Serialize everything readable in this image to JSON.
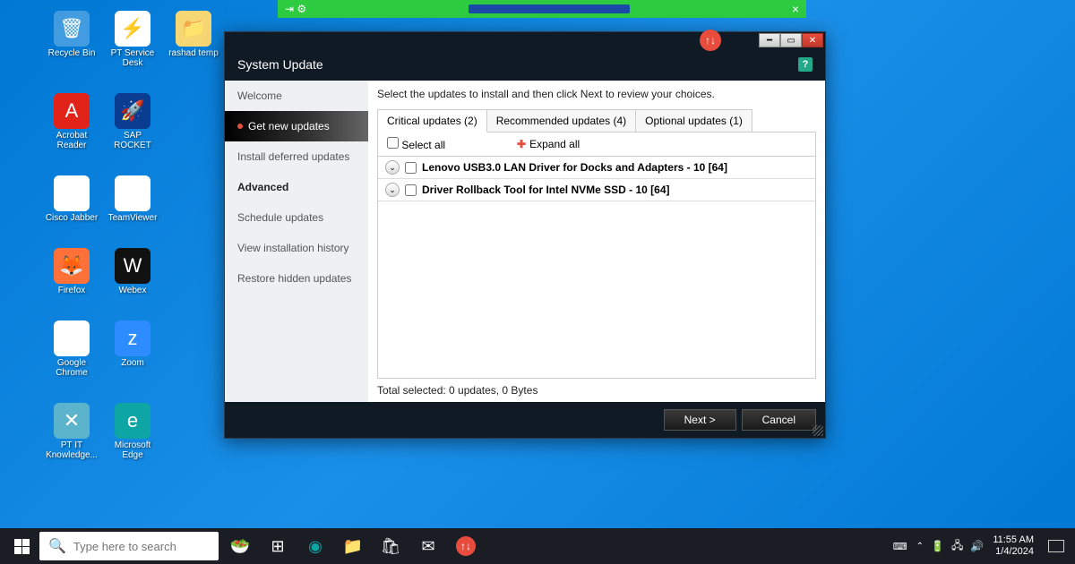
{
  "top_bar": {
    "close": "×"
  },
  "desktop": {
    "icons": [
      {
        "label": "Recycle Bin",
        "color": "#ffffff40",
        "glyph": "🗑"
      },
      {
        "label": "PT Service Desk",
        "color": "#fff",
        "glyph": "⚡"
      },
      {
        "label": "rashad temp",
        "color": "#f7d774",
        "glyph": "📁"
      },
      {
        "label": "Acrobat Reader",
        "color": "#e2231a",
        "glyph": "A"
      },
      {
        "label": "SAP ROCKET",
        "color": "#0a3d91",
        "glyph": "🚀"
      },
      {
        "label": "",
        "color": "transparent",
        "glyph": ""
      },
      {
        "label": "Cisco Jabber",
        "color": "#fff",
        "glyph": "◐"
      },
      {
        "label": "TeamViewer",
        "color": "#fff",
        "glyph": "↔"
      },
      {
        "label": "",
        "color": "transparent",
        "glyph": ""
      },
      {
        "label": "Firefox",
        "color": "#ff7139",
        "glyph": "🦊"
      },
      {
        "label": "Webex",
        "color": "#111",
        "glyph": "W"
      },
      {
        "label": "",
        "color": "transparent",
        "glyph": ""
      },
      {
        "label": "Google Chrome",
        "color": "#fff",
        "glyph": "◉"
      },
      {
        "label": "Zoom",
        "color": "#2d8cff",
        "glyph": "z"
      },
      {
        "label": "",
        "color": "transparent",
        "glyph": ""
      },
      {
        "label": "PT IT Knowledge...",
        "color": "#5cb3cc",
        "glyph": "✕"
      },
      {
        "label": "Microsoft Edge",
        "color": "#0ea5a5",
        "glyph": "e"
      }
    ]
  },
  "window": {
    "title": "System Update",
    "instruction": "Select the updates to install and then click Next to review your choices.",
    "sidebar": {
      "items": [
        "Welcome",
        "Get new updates",
        "Install deferred updates"
      ],
      "heading": "Advanced",
      "adv_items": [
        "Schedule updates",
        "View installation history",
        "Restore hidden updates"
      ]
    },
    "tabs": [
      {
        "label": "Critical updates (2)"
      },
      {
        "label": "Recommended updates (4)"
      },
      {
        "label": "Optional updates (1)"
      }
    ],
    "select_all": "Select all",
    "expand_all": "Expand all",
    "updates": [
      {
        "name": "Lenovo USB3.0 LAN Driver for Docks and Adapters - 10 [64]"
      },
      {
        "name": "Driver Rollback Tool for Intel NVMe SSD - 10 [64]"
      }
    ],
    "status": "Total selected: 0 updates,  0 Bytes",
    "next": "Next >",
    "cancel": "Cancel"
  },
  "taskbar": {
    "search_placeholder": "Type here to search",
    "time": "11:55 AM",
    "date": "1/4/2024"
  }
}
